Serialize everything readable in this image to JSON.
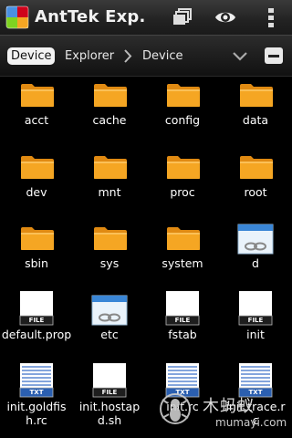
{
  "app": {
    "title": "AntTek Exp.",
    "icons": [
      "app-logo-icon",
      "windows-icon",
      "eye-icon",
      "overflow-menu-icon"
    ]
  },
  "breadcrumb": {
    "items": [
      "Device",
      "Explorer",
      "Device"
    ],
    "icons": [
      "chevron-right-icon",
      "chevron-down-icon",
      "minus-icon"
    ]
  },
  "colors": {
    "folder": "#f5a623",
    "folder_dark": "#e08a12",
    "titlebar": "#2a2a2a",
    "background": "#000000",
    "crumb_active_bg": "#f3f3f3"
  },
  "items": [
    {
      "name": "acct",
      "type": "folder"
    },
    {
      "name": "cache",
      "type": "folder"
    },
    {
      "name": "config",
      "type": "folder"
    },
    {
      "name": "data",
      "type": "folder"
    },
    {
      "name": "dev",
      "type": "folder"
    },
    {
      "name": "mnt",
      "type": "folder"
    },
    {
      "name": "proc",
      "type": "folder"
    },
    {
      "name": "root",
      "type": "folder"
    },
    {
      "name": "sbin",
      "type": "folder"
    },
    {
      "name": "sys",
      "type": "folder"
    },
    {
      "name": "system",
      "type": "folder"
    },
    {
      "name": "d",
      "type": "link"
    },
    {
      "name": "default.prop",
      "type": "file",
      "badge": "FILE"
    },
    {
      "name": "etc",
      "type": "link"
    },
    {
      "name": "fstab",
      "type": "file",
      "badge": "FILE"
    },
    {
      "name": "init",
      "type": "file",
      "badge": "FILE"
    },
    {
      "name": "init.goldfish.rc",
      "type": "txt",
      "badge": "TXT"
    },
    {
      "name": "init.hostapd.sh",
      "type": "file",
      "badge": "FILE"
    },
    {
      "name": "init.rc",
      "type": "txt",
      "badge": "TXT"
    },
    {
      "name": "init.trace.rc",
      "type": "txt",
      "badge": "TXT"
    }
  ],
  "watermark": {
    "text": "木蚂蚁",
    "domain": "mumayi.com"
  }
}
